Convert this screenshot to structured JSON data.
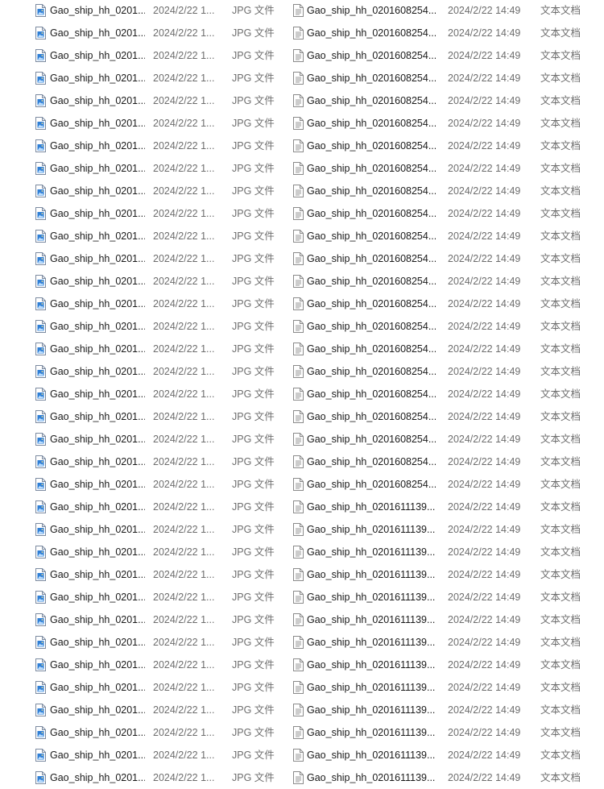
{
  "left_list": {
    "icon": "image-file-icon",
    "rows": [
      {
        "name": "Gao_ship_hh_0201...",
        "date": "2024/2/22 1...",
        "type": "JPG 文件"
      },
      {
        "name": "Gao_ship_hh_0201...",
        "date": "2024/2/22 1...",
        "type": "JPG 文件"
      },
      {
        "name": "Gao_ship_hh_0201...",
        "date": "2024/2/22 1...",
        "type": "JPG 文件"
      },
      {
        "name": "Gao_ship_hh_0201...",
        "date": "2024/2/22 1...",
        "type": "JPG 文件"
      },
      {
        "name": "Gao_ship_hh_0201...",
        "date": "2024/2/22 1...",
        "type": "JPG 文件"
      },
      {
        "name": "Gao_ship_hh_0201...",
        "date": "2024/2/22 1...",
        "type": "JPG 文件"
      },
      {
        "name": "Gao_ship_hh_0201...",
        "date": "2024/2/22 1...",
        "type": "JPG 文件"
      },
      {
        "name": "Gao_ship_hh_0201...",
        "date": "2024/2/22 1...",
        "type": "JPG 文件"
      },
      {
        "name": "Gao_ship_hh_0201...",
        "date": "2024/2/22 1...",
        "type": "JPG 文件"
      },
      {
        "name": "Gao_ship_hh_0201...",
        "date": "2024/2/22 1...",
        "type": "JPG 文件"
      },
      {
        "name": "Gao_ship_hh_0201...",
        "date": "2024/2/22 1...",
        "type": "JPG 文件"
      },
      {
        "name": "Gao_ship_hh_0201...",
        "date": "2024/2/22 1...",
        "type": "JPG 文件"
      },
      {
        "name": "Gao_ship_hh_0201...",
        "date": "2024/2/22 1...",
        "type": "JPG 文件"
      },
      {
        "name": "Gao_ship_hh_0201...",
        "date": "2024/2/22 1...",
        "type": "JPG 文件"
      },
      {
        "name": "Gao_ship_hh_0201...",
        "date": "2024/2/22 1...",
        "type": "JPG 文件"
      },
      {
        "name": "Gao_ship_hh_0201...",
        "date": "2024/2/22 1...",
        "type": "JPG 文件"
      },
      {
        "name": "Gao_ship_hh_0201...",
        "date": "2024/2/22 1...",
        "type": "JPG 文件"
      },
      {
        "name": "Gao_ship_hh_0201...",
        "date": "2024/2/22 1...",
        "type": "JPG 文件"
      },
      {
        "name": "Gao_ship_hh_0201...",
        "date": "2024/2/22 1...",
        "type": "JPG 文件"
      },
      {
        "name": "Gao_ship_hh_0201...",
        "date": "2024/2/22 1...",
        "type": "JPG 文件"
      },
      {
        "name": "Gao_ship_hh_0201...",
        "date": "2024/2/22 1...",
        "type": "JPG 文件"
      },
      {
        "name": "Gao_ship_hh_0201...",
        "date": "2024/2/22 1...",
        "type": "JPG 文件"
      },
      {
        "name": "Gao_ship_hh_0201...",
        "date": "2024/2/22 1...",
        "type": "JPG 文件"
      },
      {
        "name": "Gao_ship_hh_0201...",
        "date": "2024/2/22 1...",
        "type": "JPG 文件"
      },
      {
        "name": "Gao_ship_hh_0201...",
        "date": "2024/2/22 1...",
        "type": "JPG 文件"
      },
      {
        "name": "Gao_ship_hh_0201...",
        "date": "2024/2/22 1...",
        "type": "JPG 文件"
      },
      {
        "name": "Gao_ship_hh_0201...",
        "date": "2024/2/22 1...",
        "type": "JPG 文件"
      },
      {
        "name": "Gao_ship_hh_0201...",
        "date": "2024/2/22 1...",
        "type": "JPG 文件"
      },
      {
        "name": "Gao_ship_hh_0201...",
        "date": "2024/2/22 1...",
        "type": "JPG 文件"
      },
      {
        "name": "Gao_ship_hh_0201...",
        "date": "2024/2/22 1...",
        "type": "JPG 文件"
      },
      {
        "name": "Gao_ship_hh_0201...",
        "date": "2024/2/22 1...",
        "type": "JPG 文件"
      },
      {
        "name": "Gao_ship_hh_0201...",
        "date": "2024/2/22 1...",
        "type": "JPG 文件"
      },
      {
        "name": "Gao_ship_hh_0201...",
        "date": "2024/2/22 1...",
        "type": "JPG 文件"
      },
      {
        "name": "Gao_ship_hh_0201...",
        "date": "2024/2/22 1...",
        "type": "JPG 文件"
      },
      {
        "name": "Gao_ship_hh_0201...",
        "date": "2024/2/22 1...",
        "type": "JPG 文件"
      }
    ]
  },
  "right_list": {
    "icon": "text-document-icon",
    "rows": [
      {
        "name": "Gao_ship_hh_0201608254...",
        "date": "2024/2/22 14:49",
        "type": "文本文档"
      },
      {
        "name": "Gao_ship_hh_0201608254...",
        "date": "2024/2/22 14:49",
        "type": "文本文档"
      },
      {
        "name": "Gao_ship_hh_0201608254...",
        "date": "2024/2/22 14:49",
        "type": "文本文档"
      },
      {
        "name": "Gao_ship_hh_0201608254...",
        "date": "2024/2/22 14:49",
        "type": "文本文档"
      },
      {
        "name": "Gao_ship_hh_0201608254...",
        "date": "2024/2/22 14:49",
        "type": "文本文档"
      },
      {
        "name": "Gao_ship_hh_0201608254...",
        "date": "2024/2/22 14:49",
        "type": "文本文档"
      },
      {
        "name": "Gao_ship_hh_0201608254...",
        "date": "2024/2/22 14:49",
        "type": "文本文档"
      },
      {
        "name": "Gao_ship_hh_0201608254...",
        "date": "2024/2/22 14:49",
        "type": "文本文档"
      },
      {
        "name": "Gao_ship_hh_0201608254...",
        "date": "2024/2/22 14:49",
        "type": "文本文档"
      },
      {
        "name": "Gao_ship_hh_0201608254...",
        "date": "2024/2/22 14:49",
        "type": "文本文档"
      },
      {
        "name": "Gao_ship_hh_0201608254...",
        "date": "2024/2/22 14:49",
        "type": "文本文档"
      },
      {
        "name": "Gao_ship_hh_0201608254...",
        "date": "2024/2/22 14:49",
        "type": "文本文档"
      },
      {
        "name": "Gao_ship_hh_0201608254...",
        "date": "2024/2/22 14:49",
        "type": "文本文档"
      },
      {
        "name": "Gao_ship_hh_0201608254...",
        "date": "2024/2/22 14:49",
        "type": "文本文档"
      },
      {
        "name": "Gao_ship_hh_0201608254...",
        "date": "2024/2/22 14:49",
        "type": "文本文档"
      },
      {
        "name": "Gao_ship_hh_0201608254...",
        "date": "2024/2/22 14:49",
        "type": "文本文档"
      },
      {
        "name": "Gao_ship_hh_0201608254...",
        "date": "2024/2/22 14:49",
        "type": "文本文档"
      },
      {
        "name": "Gao_ship_hh_0201608254...",
        "date": "2024/2/22 14:49",
        "type": "文本文档"
      },
      {
        "name": "Gao_ship_hh_0201608254...",
        "date": "2024/2/22 14:49",
        "type": "文本文档"
      },
      {
        "name": "Gao_ship_hh_0201608254...",
        "date": "2024/2/22 14:49",
        "type": "文本文档"
      },
      {
        "name": "Gao_ship_hh_0201608254...",
        "date": "2024/2/22 14:49",
        "type": "文本文档"
      },
      {
        "name": "Gao_ship_hh_0201608254...",
        "date": "2024/2/22 14:49",
        "type": "文本文档"
      },
      {
        "name": "Gao_ship_hh_0201611139...",
        "date": "2024/2/22 14:49",
        "type": "文本文档"
      },
      {
        "name": "Gao_ship_hh_0201611139...",
        "date": "2024/2/22 14:49",
        "type": "文本文档"
      },
      {
        "name": "Gao_ship_hh_0201611139...",
        "date": "2024/2/22 14:49",
        "type": "文本文档"
      },
      {
        "name": "Gao_ship_hh_0201611139...",
        "date": "2024/2/22 14:49",
        "type": "文本文档"
      },
      {
        "name": "Gao_ship_hh_0201611139...",
        "date": "2024/2/22 14:49",
        "type": "文本文档"
      },
      {
        "name": "Gao_ship_hh_0201611139...",
        "date": "2024/2/22 14:49",
        "type": "文本文档"
      },
      {
        "name": "Gao_ship_hh_0201611139...",
        "date": "2024/2/22 14:49",
        "type": "文本文档"
      },
      {
        "name": "Gao_ship_hh_0201611139...",
        "date": "2024/2/22 14:49",
        "type": "文本文档"
      },
      {
        "name": "Gao_ship_hh_0201611139...",
        "date": "2024/2/22 14:49",
        "type": "文本文档"
      },
      {
        "name": "Gao_ship_hh_0201611139...",
        "date": "2024/2/22 14:49",
        "type": "文本文档"
      },
      {
        "name": "Gao_ship_hh_0201611139...",
        "date": "2024/2/22 14:49",
        "type": "文本文档"
      },
      {
        "name": "Gao_ship_hh_0201611139...",
        "date": "2024/2/22 14:49",
        "type": "文本文档"
      },
      {
        "name": "Gao_ship_hh_0201611139...",
        "date": "2024/2/22 14:49",
        "type": "文本文档"
      }
    ]
  },
  "colors": {
    "text_primary": "#1a1a1a",
    "text_secondary": "#6d6d6d",
    "jpg_icon_blue": "#2f7fd6",
    "txt_icon_gray": "#8a8a8a"
  }
}
